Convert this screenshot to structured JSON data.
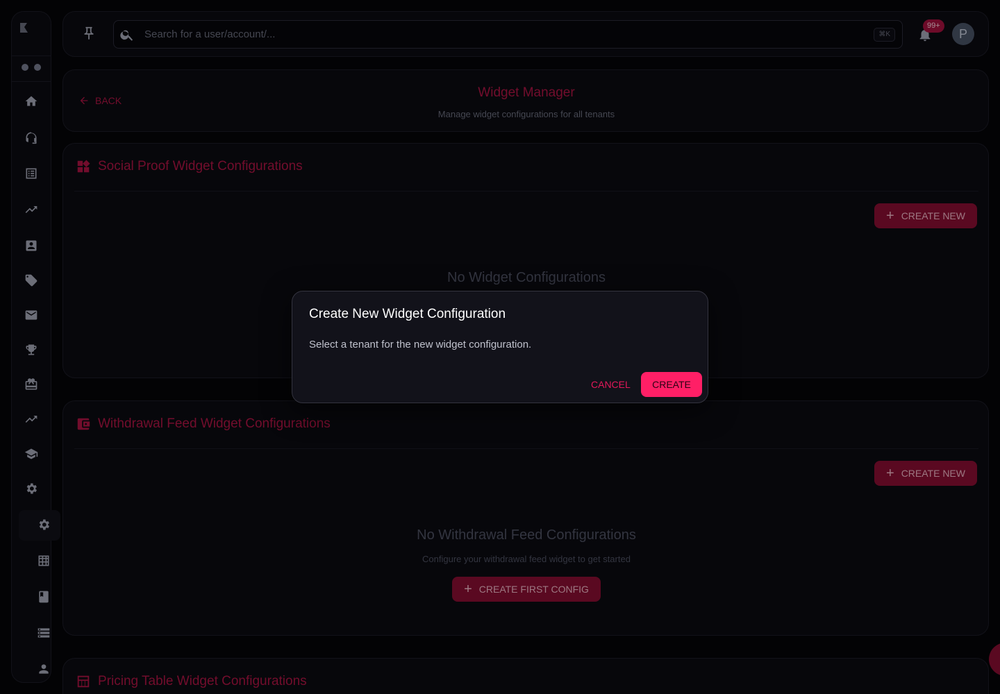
{
  "topbar": {
    "search_placeholder": "Search for a user/account/...",
    "shortcut": "⌘K",
    "notification_badge": "99+",
    "avatar_letter": "P"
  },
  "header": {
    "back_label": "BACK",
    "title": "Widget Manager",
    "subtitle": "Manage widget configurations for all tenants"
  },
  "sections": [
    {
      "title": "Social Proof Widget Configurations",
      "create_label": "CREATE NEW",
      "empty_title": "No Widget Configurations"
    },
    {
      "title": "Withdrawal Feed Widget Configurations",
      "create_label": "CREATE NEW",
      "empty_title": "No Withdrawal Feed Configurations",
      "empty_subtitle": "Configure your withdrawal feed widget to get started",
      "first_config_label": "CREATE FIRST CONFIG"
    },
    {
      "title": "Pricing Table Widget Configurations"
    }
  ],
  "dialog": {
    "title": "Create New Widget Configuration",
    "text": "Select a tenant for the new widget configuration.",
    "cancel_label": "CANCEL",
    "create_label": "CREATE"
  },
  "sidebar_icons": [
    "home-icon",
    "support-icon",
    "list-icon",
    "trending-icon",
    "contact-icon",
    "tag-icon",
    "mail-icon",
    "trophy-icon",
    "gift-icon",
    "trending-icon",
    "school-icon",
    "settings-icon",
    "settings-icon",
    "grid-icon",
    "book-icon",
    "storage-icon",
    "person-icon"
  ],
  "colors": {
    "accent": "#b01544",
    "accent_bright": "#ff1f66",
    "background": "#050508",
    "panel": "#0b0b12"
  }
}
